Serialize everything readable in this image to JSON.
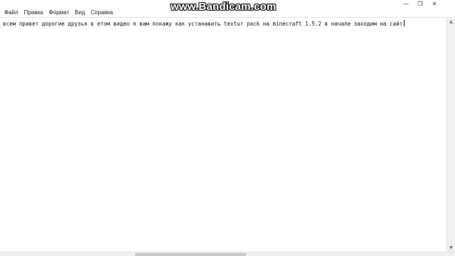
{
  "watermark": {
    "text": "www.Bandicam.com"
  },
  "window_controls": {
    "minimize_glyph": "—",
    "maximize_glyph": "❐",
    "close_glyph": "✕"
  },
  "menubar": {
    "items": [
      {
        "label": "Файл"
      },
      {
        "label": "Правка"
      },
      {
        "label": "Формат"
      },
      {
        "label": "Вид"
      },
      {
        "label": "Справка"
      }
    ]
  },
  "editor": {
    "content": "всем привет дорогие друзья в етом видео я вам покажу как устанавить textur pack на minecraft 1.5.2 в начале заходим на сайт"
  },
  "scrollbar": {
    "up_glyph": "▲",
    "down_glyph": "▼"
  }
}
